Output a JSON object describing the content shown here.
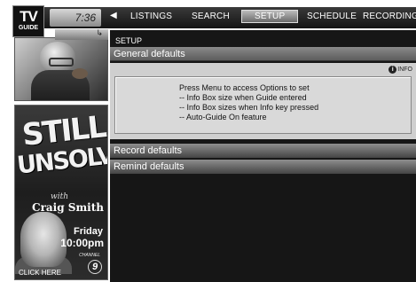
{
  "logo": {
    "line1": "TV",
    "line2": "GUIDE"
  },
  "clock": "7:36",
  "nav": {
    "tabs": [
      {
        "label": "LISTINGS"
      },
      {
        "label": "SEARCH"
      },
      {
        "label": "SETUP"
      },
      {
        "label": "SCHEDULE"
      },
      {
        "label": "RECORDINGS"
      }
    ],
    "active_tab": "SETUP"
  },
  "ad": {
    "title_line1": "STILL",
    "title_line2": "UNSOLVED",
    "with": "with",
    "host": "Craig Smith",
    "day": "Friday",
    "time": "10:00pm",
    "channel_label": "CHANNEL",
    "channel_number": "9",
    "cta": "CLICK HERE"
  },
  "main": {
    "section": "SETUP",
    "general_defaults": "General defaults",
    "info_badge": "INFO",
    "info_lines": [
      "Press Menu to access Options to set",
      "-- Info Box size when Guide entered",
      "-- Info Box sizes when Info key pressed",
      "-- Auto-Guide On feature"
    ],
    "record_defaults": "Record defaults",
    "remind_defaults": "Remind defaults"
  }
}
